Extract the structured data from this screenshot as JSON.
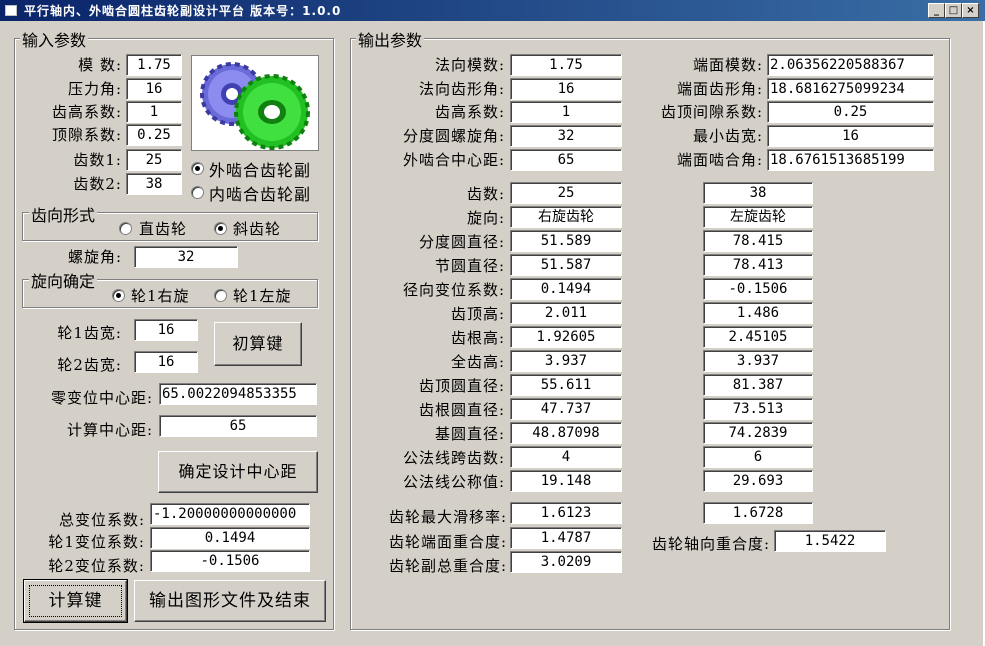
{
  "window": {
    "title": "平行轴内、外啮合圆柱齿轮副设计平台  版本号：1.0.0",
    "minimize": "_",
    "maximize": "□",
    "close": "×"
  },
  "input": {
    "legend": "输入参数",
    "module_label": "模    数:",
    "module": "1.75",
    "pressure_label": "压力角:",
    "pressure": "16",
    "addendum_label": "齿高系数:",
    "addendum": "1",
    "clearance_label": "顶隙系数:",
    "clearance": "0.25",
    "z1_label": "齿数1:",
    "z1": "25",
    "z2_label": "齿数2:",
    "z2": "38",
    "mesh_external": "外啮合齿轮副",
    "mesh_internal": "内啮合齿轮副",
    "tooth_legend": "齿向形式",
    "spur": "直齿轮",
    "helical": "斜齿轮",
    "helix_label": "螺旋角:",
    "helix": "32",
    "hand_legend": "旋向确定",
    "gear1_right": "轮1右旋",
    "gear1_left": "轮1左旋",
    "width1_label": "轮1齿宽:",
    "width1": "16",
    "width2_label": "轮2齿宽:",
    "width2": "16",
    "initial_calc": "初算键",
    "zero_center_label": "零变位中心距:",
    "zero_center": "65.0022094853355",
    "calc_center_label": "计算中心距:",
    "calc_center": "65",
    "confirm_center": "确定设计中心距",
    "total_shift_label": "总变位系数:",
    "total_shift": "-1.20000000000000",
    "shift1_label": "轮1变位系数:",
    "shift1": "0.1494",
    "shift2_label": "轮2变位系数:",
    "shift2": "-0.1506",
    "calculate": "计算键",
    "export": "输出图形文件及结束"
  },
  "output": {
    "legend": "输出参数",
    "normal_module_label": "法向模数:",
    "normal_module": "1.75",
    "normal_pressure_label": "法向齿形角:",
    "normal_pressure": "16",
    "addendum_label": "齿高系数:",
    "addendum": "1",
    "helix_label": "分度圆螺旋角:",
    "helix": "32",
    "center_label": "外啮合中心距:",
    "center": "65",
    "transverse_module_label": "端面模数:",
    "transverse_module": "2.06356220588367",
    "transverse_pressure_label": "端面齿形角:",
    "transverse_pressure": "18.6816275099234",
    "tip_clearance_label": "齿顶间隙系数:",
    "tip_clearance": "0.25",
    "min_width_label": "最小齿宽:",
    "min_width": "16",
    "transverse_mesh_label": "端面啮合角:",
    "transverse_mesh": "18.6761513685199",
    "rows": [
      {
        "label": "齿数:",
        "g1": "25",
        "g2": "38"
      },
      {
        "label": "旋向:",
        "g1": "右旋齿轮",
        "g2": "左旋齿轮"
      },
      {
        "label": "分度圆直径:",
        "g1": "51.589",
        "g2": "78.415"
      },
      {
        "label": "节圆直径:",
        "g1": "51.587",
        "g2": "78.413"
      },
      {
        "label": "径向变位系数:",
        "g1": "0.1494",
        "g2": "-0.1506"
      },
      {
        "label": "齿顶高:",
        "g1": "2.011",
        "g2": "1.486"
      },
      {
        "label": "齿根高:",
        "g1": "1.92605",
        "g2": "2.45105"
      },
      {
        "label": "全齿高:",
        "g1": "3.937",
        "g2": "3.937"
      },
      {
        "label": "齿顶圆直径:",
        "g1": "55.611",
        "g2": "81.387"
      },
      {
        "label": "齿根圆直径:",
        "g1": "47.737",
        "g2": "73.513"
      },
      {
        "label": "基圆直径:",
        "g1": "48.87098",
        "g2": "74.2839"
      },
      {
        "label": "公法线跨齿数:",
        "g1": "4",
        "g2": "6"
      },
      {
        "label": "公法线公称值:",
        "g1": "19.148",
        "g2": "29.693"
      }
    ],
    "max_slip_label": "齿轮最大滑移率:",
    "max_slip1": "1.6123",
    "max_slip2": "1.6728",
    "transverse_contact_label": "齿轮端面重合度:",
    "transverse_contact": "1.4787",
    "axial_contact_label": "齿轮轴向重合度:",
    "axial_contact": "1.5422",
    "total_contact_label": "齿轮副总重合度:",
    "total_contact": "3.0209"
  },
  "colors": {
    "titlebar": "#0a246a",
    "gear_blue": "#6a6ad8",
    "gear_green": "#22c022",
    "face": "#d4d0c8"
  }
}
